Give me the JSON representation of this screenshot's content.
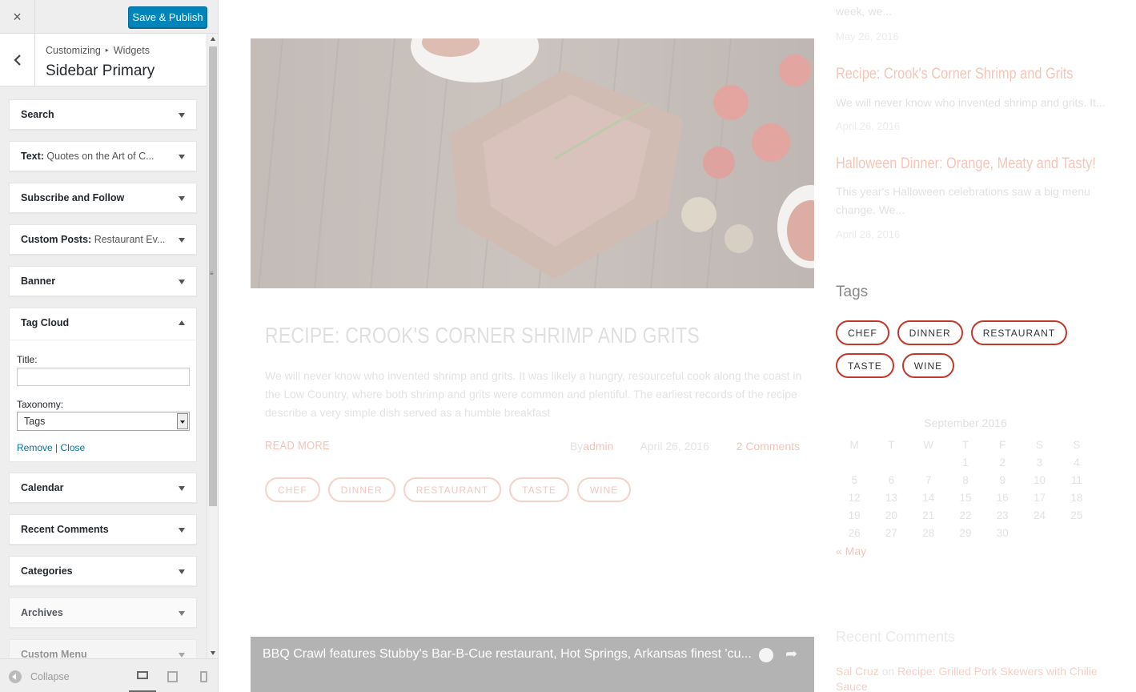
{
  "customizer": {
    "close_label": "×",
    "save_label": "Save & Publish",
    "breadcrumb": [
      "Customizing",
      "Widgets"
    ],
    "panel_title": "Sidebar Primary",
    "widgets": [
      {
        "title": "Search",
        "subtitle": ""
      },
      {
        "title": "Text:",
        "subtitle": "Quotes on the Art of C..."
      },
      {
        "title": "Subscribe and Follow",
        "subtitle": ""
      },
      {
        "title": "Custom Posts:",
        "subtitle": "Restaurant Ev..."
      },
      {
        "title": "Banner",
        "subtitle": ""
      },
      {
        "title": "Tag Cloud",
        "subtitle": ""
      },
      {
        "title": "Calendar",
        "subtitle": ""
      },
      {
        "title": "Recent Comments",
        "subtitle": ""
      },
      {
        "title": "Categories",
        "subtitle": ""
      },
      {
        "title": "Archives",
        "subtitle": ""
      },
      {
        "title": "Custom Menu",
        "subtitle": ""
      }
    ],
    "tag_cloud_form": {
      "title_label": "Title:",
      "title_value": "",
      "taxonomy_label": "Taxonomy:",
      "taxonomy_value": "Tags",
      "remove_label": "Remove",
      "separator": "|",
      "close_label": "Close"
    },
    "footer": {
      "collapse_label": "Collapse",
      "devices": [
        "desktop",
        "tablet",
        "mobile"
      ],
      "active_device": "desktop"
    }
  },
  "preview": {
    "top_snippet": {
      "excerpt": "week, we...",
      "date": "May 26, 2016"
    },
    "side_posts": [
      {
        "title": "Recipe: Crook's Corner Shrimp and Grits",
        "excerpt": "We will never know who invented shrimp and grits. It...",
        "date": "April 26, 2016"
      },
      {
        "title": "Halloween Dinner: Orange, Meaty and Tasty!",
        "excerpt_lines": [
          "This year's Halloween celebrations saw a big menu",
          "change. We..."
        ],
        "date": "April 26, 2016"
      }
    ],
    "post": {
      "title": "RECIPE: CROOK'S CORNER SHRIMP AND GRITS",
      "excerpt": "We will never know who invented shrimp and grits. It was likely a hungry, resourceful cook along the coast in the Low Country, where both shrimp and grits were common and plentiful. The earliest records of the recipe describe a very simple dish served as a humble breakfast",
      "read_more": "READ MORE",
      "by_label": "By",
      "author": "admin",
      "date": "April 26, 2016",
      "comments": "2 Comments",
      "tags": [
        "CHEF",
        "DINNER",
        "RESTAURANT",
        "TASTE",
        "WINE"
      ]
    },
    "video_title": "BBQ Crawl features Stubby's Bar-B-Cue restaurant, Hot Springs, Arkansas finest 'cu...",
    "tags_heading": "Tags",
    "tag_cloud": [
      "CHEF",
      "DINNER",
      "RESTAURANT",
      "TASTE",
      "WINE"
    ],
    "calendar": {
      "caption": "September 2016",
      "weekdays": [
        "M",
        "T",
        "W",
        "T",
        "F",
        "S",
        "S"
      ],
      "cells": [
        "",
        "",
        "",
        "1",
        "2",
        "3",
        "4",
        "5",
        "6",
        "7",
        "8",
        "9",
        "10",
        "11",
        "12",
        "13",
        "14",
        "15",
        "16",
        "17",
        "18",
        "19",
        "20",
        "21",
        "22",
        "23",
        "24",
        "25",
        "26",
        "27",
        "28",
        "29",
        "30",
        "",
        ""
      ],
      "prev_link": "« May"
    },
    "recent_comments": {
      "heading": "Recent Comments",
      "author": "Sal Cruz",
      "on": "on",
      "post_line1": "Recipe: Grilled Pork Skewers with Chilie",
      "post_line2": "Sauce"
    },
    "colors": {
      "accent": "#c0392b",
      "primary_button": "#0085ba",
      "link": "#0073aa"
    }
  }
}
